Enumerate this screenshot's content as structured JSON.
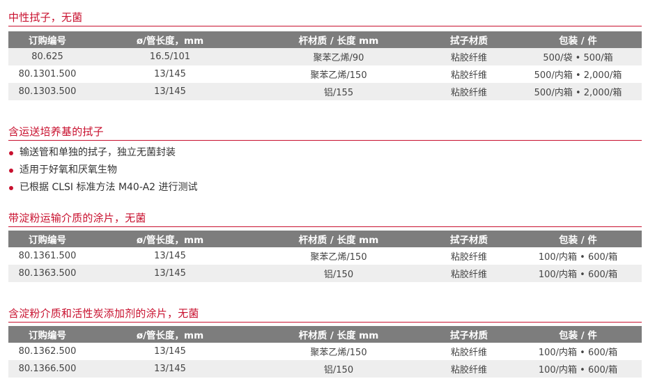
{
  "sections": [
    {
      "title": "中性拭子，无菌",
      "headers": [
        "订购编号",
        "ø/管长度，mm",
        "杆材质 / 长度 mm",
        "拭子材质",
        "包装 / 件"
      ],
      "rows": [
        [
          "80.625",
          "16.5/101",
          "聚苯乙烯/90",
          "粘胶纤维",
          "500/袋 • 500/箱"
        ],
        [
          "80.1301.500",
          "13/145",
          "聚苯乙烯/150",
          "粘胶纤维",
          "500/内箱 • 2,000/箱"
        ],
        [
          "80.1303.500",
          "13/145",
          "铝/155",
          "粘胶纤维",
          "500/内箱 • 2,000/箱"
        ]
      ]
    },
    {
      "title": "含运送培养基的拭子",
      "bullets": [
        "输送管和单独的拭子，独立无菌封装",
        "适用于好氧和厌氧生物",
        "已根据 CLSI 标准方法 M40-A2 进行测试"
      ]
    },
    {
      "title": "带淀粉运输介质的涂片，无菌",
      "headers": [
        "订购编号",
        "ø/管长度，mm",
        "杆材质 / 长度 mm",
        "拭子材质",
        "包装 / 件"
      ],
      "rows": [
        [
          "80.1361.500",
          "13/145",
          "聚苯乙烯/150",
          "粘胶纤维",
          "100/内箱 • 600/箱"
        ],
        [
          "80.1363.500",
          "13/145",
          "铝/150",
          "粘胶纤维",
          "100/内箱 • 600/箱"
        ]
      ]
    },
    {
      "title": "含淀粉介质和活性炭添加剂的涂片，无菌",
      "headers": [
        "订购编号",
        "ø/管长度，mm",
        "杆材质 / 长度 mm",
        "拭子材质",
        "包装 / 件"
      ],
      "rows": [
        [
          "80.1362.500",
          "13/145",
          "聚苯乙烯/150",
          "粘胶纤维",
          "100/内箱 • 600/箱"
        ],
        [
          "80.1366.500",
          "13/145",
          "铝/150",
          "粘胶纤维",
          "100/内箱 • 600/箱"
        ]
      ]
    }
  ],
  "colors": {
    "accent": "#c8102e",
    "header_bg": "#7d7d7d",
    "row_alt": "#eeeeee"
  }
}
